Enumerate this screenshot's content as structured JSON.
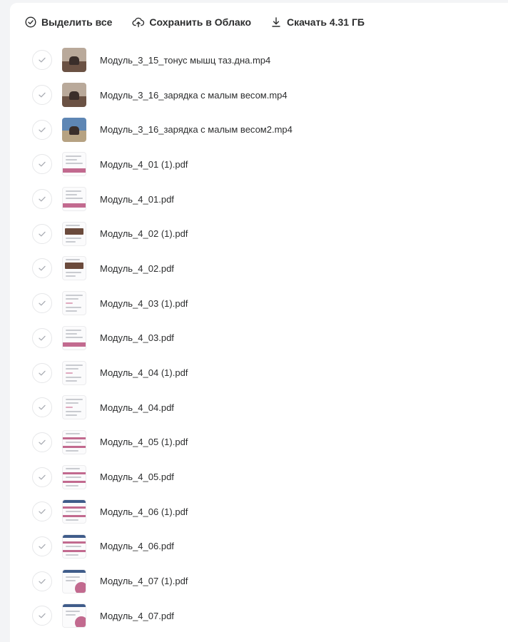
{
  "toolbar": {
    "select_all_label": "Выделить все",
    "save_cloud_label": "Сохранить в Облако",
    "download_label": "Скачать 4.31 ГБ"
  },
  "files": [
    {
      "name": "Модуль_3_15_тонус мышц таз.дна.mp4",
      "kind": "video",
      "thumb": "video"
    },
    {
      "name": "Модуль_3_16_зарядка с малым весом.mp4",
      "kind": "video",
      "thumb": "video"
    },
    {
      "name": "Модуль_3_16_зарядка с малым весом2.mp4",
      "kind": "video",
      "thumb": "video-alt"
    },
    {
      "name": "Модуль_4_01 (1).pdf",
      "kind": "pdf",
      "thumb": "pdf-band"
    },
    {
      "name": "Модуль_4_01.pdf",
      "kind": "pdf",
      "thumb": "pdf-band"
    },
    {
      "name": "Модуль_4_02 (1).pdf",
      "kind": "pdf",
      "thumb": "pdf-photo"
    },
    {
      "name": "Модуль_4_02.pdf",
      "kind": "pdf",
      "thumb": "pdf-photo"
    },
    {
      "name": "Модуль_4_03 (1).pdf",
      "kind": "pdf",
      "thumb": "pdf-lines"
    },
    {
      "name": "Модуль_4_03.pdf",
      "kind": "pdf",
      "thumb": "pdf-band"
    },
    {
      "name": "Модуль_4_04 (1).pdf",
      "kind": "pdf",
      "thumb": "pdf-lines"
    },
    {
      "name": "Модуль_4_04.pdf",
      "kind": "pdf",
      "thumb": "pdf-lines"
    },
    {
      "name": "Модуль_4_05 (1).pdf",
      "kind": "pdf",
      "thumb": "pdf-stripes"
    },
    {
      "name": "Модуль_4_05.pdf",
      "kind": "pdf",
      "thumb": "pdf-stripes"
    },
    {
      "name": "Модуль_4_06 (1).pdf",
      "kind": "pdf",
      "thumb": "pdf-blue-stripes"
    },
    {
      "name": "Модуль_4_06.pdf",
      "kind": "pdf",
      "thumb": "pdf-blue-stripes"
    },
    {
      "name": "Модуль_4_07 (1).pdf",
      "kind": "pdf",
      "thumb": "pdf-blob"
    },
    {
      "name": "Модуль_4_07.pdf",
      "kind": "pdf",
      "thumb": "pdf-blob"
    }
  ],
  "colors": {
    "accent_pink": "#c26a8f",
    "doc_blue": "#3f5c8a",
    "text": "#2c2d2e",
    "check": "#a8abb2"
  },
  "icons": {
    "select_all": "check-circle-icon",
    "save_cloud": "cloud-upload-icon",
    "download": "download-icon",
    "row_check": "checkmark-icon"
  }
}
